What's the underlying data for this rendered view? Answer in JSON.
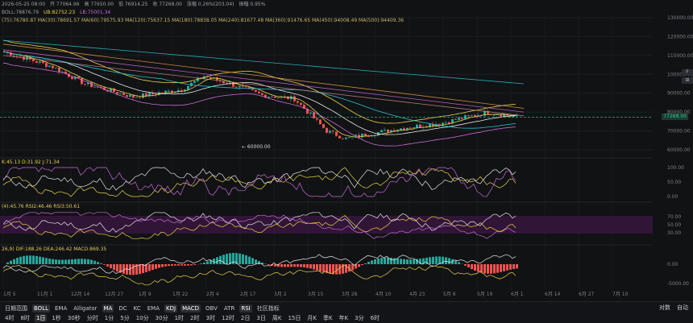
{
  "header": {
    "line1": "2026-05-25 08:00",
    "open": "开 77064.96",
    "high": "高 77650.00",
    "low": "低 76914.25",
    "close": "收 77268.00",
    "change": "涨幅 0.26%(203.04)",
    "amplitude": "振幅 0.95%",
    "boll": "BOLL:78876.79",
    "ub": "UB:82752.23",
    "lb": "LB:75001.34",
    "ma_line": "(75):76780.87  MA(30):78691.57  MA(60):79575.93  MA(120):75637.15  MA(180):78838.05  MA(240):81677.48  MA(360):91476.65  MA(450):94008.49  MA(500):94409.36"
  },
  "price_axis": [
    "130000.00",
    "120000.00",
    "110000.00",
    "100000.00",
    "90000.00",
    "80000.00",
    "70000.00",
    "60000.00"
  ],
  "current_price": "77268.00",
  "low_marker": "← 60000.00",
  "kdj": {
    "label": "K:45.13  D:31.92  J:71.34",
    "axis": [
      "100.00",
      "50.00",
      "0.00"
    ]
  },
  "rsi": {
    "label": "(4):45.76  RSI2:46.46  RSI3:50.61",
    "axis": [
      "70.00",
      "50.00",
      "30.00"
    ]
  },
  "macd": {
    "label": "26,9)  DIF:188.26  DEA:246.42  MACD:869.35",
    "axis": [
      "0.00",
      "-5000.00"
    ]
  },
  "date_axis": [
    "1月 5",
    "11月 1",
    "12月 14",
    "12月 27",
    "1月 9",
    "1月 22",
    "2月 4",
    "2月 17",
    "3月 2",
    "3月 15",
    "3月 28",
    "4月 10",
    "4月 23",
    "5月 6",
    "5月 19",
    "6月 1",
    "6月 14",
    "6月 27",
    "7月 10"
  ],
  "toolbar": {
    "row1": [
      "日期范围",
      "BOLL",
      "EMA",
      "Alligator",
      "MA",
      "DC",
      "KC",
      "EMA",
      "KDJ",
      "MACD",
      "OBV",
      "ATR",
      "RSI",
      "社区指标"
    ],
    "row1_active": [
      "BOLL",
      "MA",
      "KDJ",
      "MACD",
      "RSI"
    ],
    "row2": [
      "4时",
      "8时",
      "1日",
      "1秒",
      "30秒",
      "分时",
      "1分",
      "5分",
      "10分",
      "30分",
      "1时",
      "2时",
      "3时",
      "12时",
      "2日",
      "3日",
      "周K",
      "15日",
      "月K",
      "季K",
      "年K",
      "3分",
      "6时"
    ],
    "row2_active": [
      "1日"
    ],
    "right": [
      "对数",
      "自动"
    ]
  },
  "colors": {
    "up": "#26a69a",
    "down": "#ef5350",
    "ma_yellow": "#e8d24a",
    "ma_white": "#e6e6e6",
    "ma_purple": "#c86bd6",
    "ma_cyan": "#2bc4d6",
    "ma_orange": "#e89a4a",
    "current": "#24d18f"
  }
}
